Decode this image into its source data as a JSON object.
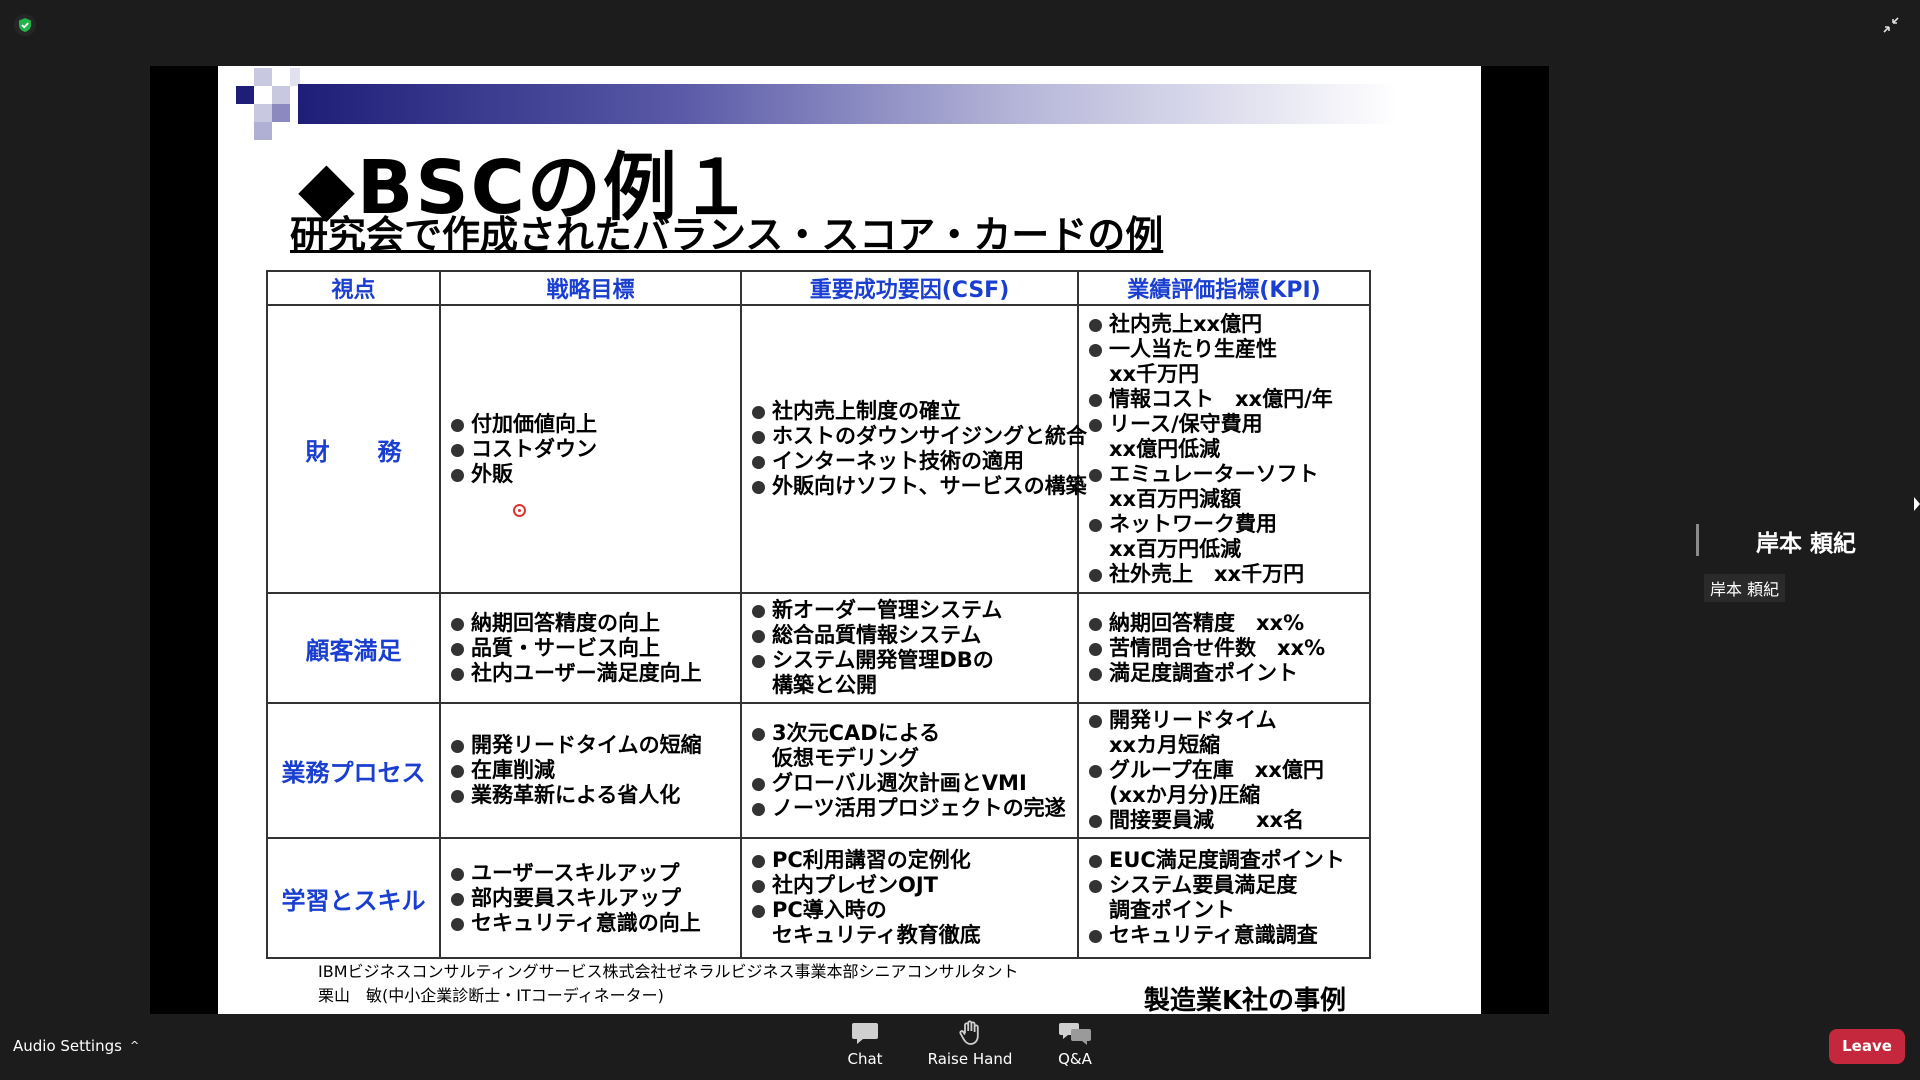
{
  "meeting": {
    "status_icon": "shield-check-icon",
    "exit_fullscreen_icon": "exit-fullscreen-icon"
  },
  "slide": {
    "title": "◆BSCの例１",
    "subtitle": "研究会で作成されたバランス・スコア・カードの例",
    "headers": [
      "視点",
      "戦略目標",
      "重要成功要因(CSF)",
      "業績評価指標(KPI)"
    ],
    "rows": [
      {
        "perspective": "財　　務",
        "objectives": [
          "付加価値向上",
          "コストダウン",
          "外販"
        ],
        "csf": [
          "社内売上制度の確立",
          "ホストのダウンサイジングと統合",
          "インターネット技術の適用",
          "外販向けソフト、サービスの構築"
        ],
        "kpi": [
          "社内売上xx億円",
          "一人当たり生産性",
          "xx千万円",
          "情報コスト　xx億円/年",
          "リース/保守費用",
          "xx億円低減",
          "エミュレーターソフト",
          "xx百万円減額",
          "ネットワーク費用",
          "xx百万円低減",
          "社外売上　xx千万円"
        ]
      },
      {
        "perspective": "顧客満足",
        "objectives": [
          "納期回答精度の向上",
          "品質・サービス向上",
          "社内ユーザー満足度向上"
        ],
        "csf": [
          "新オーダー管理システム",
          "総合品質情報システム",
          "システム開発管理DBの",
          "構築と公開"
        ],
        "kpi": [
          "納期回答精度　xx%",
          "苦情問合せ件数　xx%",
          "満足度調査ポイント"
        ]
      },
      {
        "perspective": "業務プロセス",
        "objectives": [
          "開発リードタイムの短縮",
          "在庫削減",
          "業務革新による省人化"
        ],
        "csf": [
          "3次元CADによる",
          "仮想モデリング",
          "グローバル週次計画とVMI",
          "ノーツ活用プロジェクトの完遂"
        ],
        "kpi": [
          "開発リードタイム",
          "xxカ月短縮",
          "グループ在庫　xx億円",
          "(xxか月分)圧縮",
          "間接要員減　　xx名"
        ]
      },
      {
        "perspective": "学習とスキル",
        "objectives": [
          "ユーザースキルアップ",
          "部内要員スキルアップ",
          "セキュリティ意識の向上"
        ],
        "csf": [
          "PC利用講習の定例化",
          "社内プレゼンOJT",
          "PC導入時の",
          "セキュリティ教育徹底"
        ],
        "kpi": [
          "EUC満足度調査ポイント",
          "システム要員満足度",
          "調査ポイント",
          "セキュリティ意識調査"
        ]
      }
    ],
    "credit_line1": "IBMビジネスコンサルティングサービス株式会社ゼネラルビジネス事業本部シニアコンサルタント",
    "credit_line2": "栗山　敏(中小企業診断士・ITコーディネーター)",
    "case_label": "製造業K社の事例"
  },
  "participant": {
    "name_large": "岸本 頼紀",
    "name_tag": "岸本 頼紀"
  },
  "toolbar": {
    "audio_settings": "Audio Settings",
    "audio_caret": "^",
    "chat": "Chat",
    "raise_hand": "Raise Hand",
    "qa": "Q&A",
    "leave": "Leave"
  }
}
